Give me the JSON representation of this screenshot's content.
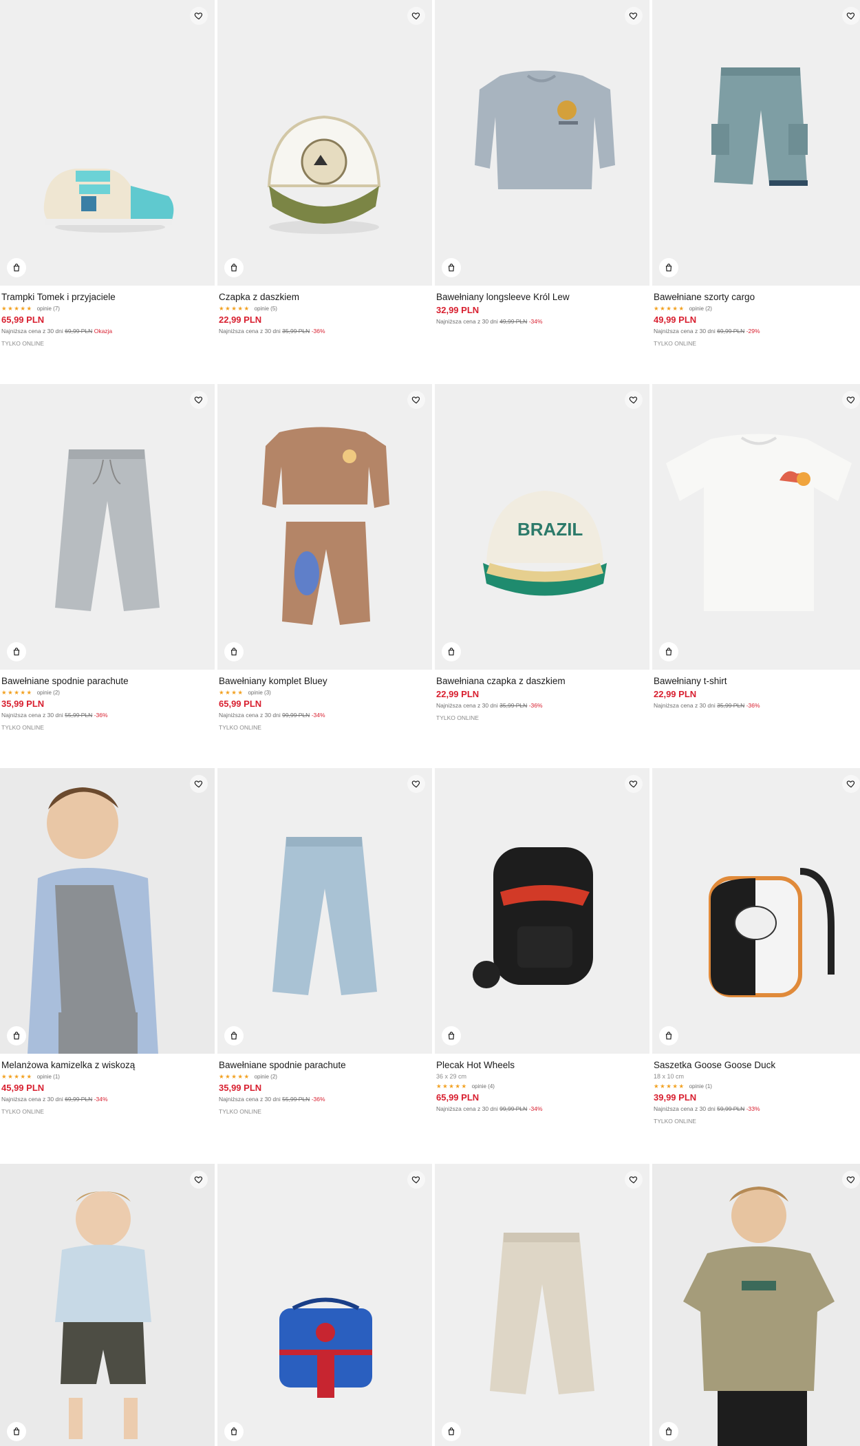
{
  "colors": {
    "price": "#d81f2f",
    "stars": "#f2a01f",
    "image_bg": "#efefef"
  },
  "icons": {
    "favorite": "heart-icon",
    "cart": "bag-icon"
  },
  "products": [
    {
      "name": "Trampki Tomek i przyjaciele",
      "stars": "★★★★★",
      "reviews": "opinie (7)",
      "price": "65,99 PLN",
      "lowest_label": "Najniższa cena z 30 dni",
      "old_price": "69,99 PLN",
      "discount": "Okazja",
      "online": "TYLKO ONLINE"
    },
    {
      "name": "Czapka z daszkiem",
      "stars": "★★★★★",
      "reviews": "opinie (5)",
      "price": "22,99 PLN",
      "lowest_label": "Najniższa cena z 30 dni",
      "old_price": "35,99 PLN",
      "discount": "-36%"
    },
    {
      "name": "Bawełniany longsleeve Król Lew",
      "price": "32,99 PLN",
      "lowest_label": "Najniższa cena z 30 dni",
      "old_price": "49,99 PLN",
      "discount": "-34%"
    },
    {
      "name": "Bawełniane szorty cargo",
      "stars": "★★★★★",
      "reviews": "opinie (2)",
      "price": "49,99 PLN",
      "lowest_label": "Najniższa cena z 30 dni",
      "old_price": "69,99 PLN",
      "discount": "-29%",
      "online": "TYLKO ONLINE"
    },
    {
      "name": "Bawełniane spodnie parachute",
      "stars": "★★★★★",
      "reviews": "opinie (2)",
      "price": "35,99 PLN",
      "lowest_label": "Najniższa cena z 30 dni",
      "old_price": "55,99 PLN",
      "discount": "-36%",
      "online": "TYLKO ONLINE"
    },
    {
      "name": "Bawełniany komplet Bluey",
      "stars": "★★★★",
      "reviews": "opinie (3)",
      "price": "65,99 PLN",
      "lowest_label": "Najniższa cena z 30 dni",
      "old_price": "99,99 PLN",
      "discount": "-34%",
      "online": "TYLKO ONLINE"
    },
    {
      "name": "Bawełniana czapka z daszkiem",
      "price": "22,99 PLN",
      "lowest_label": "Najniższa cena z 30 dni",
      "old_price": "35,99 PLN",
      "discount": "-36%",
      "online": "TYLKO ONLINE"
    },
    {
      "name": "Bawełniany t-shirt",
      "price": "22,99 PLN",
      "lowest_label": "Najniższa cena z 30 dni",
      "old_price": "35,99 PLN",
      "discount": "-36%"
    },
    {
      "name": "Melanżowa kamizelka z wiskozą",
      "stars": "★★★★★",
      "reviews": "opinie (1)",
      "price": "45,99 PLN",
      "lowest_label": "Najniższa cena z 30 dni",
      "old_price": "69,99 PLN",
      "discount": "-34%",
      "online": "TYLKO ONLINE"
    },
    {
      "name": "Bawełniane spodnie parachute",
      "stars": "★★★★★",
      "reviews": "opinie (2)",
      "price": "35,99 PLN",
      "lowest_label": "Najniższa cena z 30 dni",
      "old_price": "55,99 PLN",
      "discount": "-36%",
      "online": "TYLKO ONLINE"
    },
    {
      "name": "Plecak Hot Wheels",
      "dims": "36 x 29 cm",
      "stars": "★★★★★",
      "reviews": "opinie (4)",
      "price": "65,99 PLN",
      "lowest_label": "Najniższa cena z 30 dni",
      "old_price": "99,99 PLN",
      "discount": "-34%"
    },
    {
      "name": "Saszetka Goose Goose Duck",
      "dims": "18 x 10 cm",
      "stars": "★★★★★",
      "reviews": "opinie (1)",
      "price": "39,99 PLN",
      "lowest_label": "Najniższa cena z 30 dni",
      "old_price": "59,99 PLN",
      "discount": "-33%",
      "online": "TYLKO ONLINE"
    },
    {
      "name": ""
    },
    {
      "name": ""
    },
    {
      "name": ""
    },
    {
      "name": ""
    }
  ]
}
